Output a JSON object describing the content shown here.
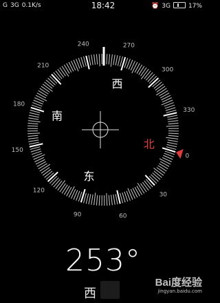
{
  "status_bar": {
    "sim1_signal": "G",
    "sim2_network": "3G",
    "data_speed": "0.1K/s",
    "time": "18:42",
    "alarm_icon": "alarm-icon",
    "network_right": "3G",
    "battery_percent": "17%",
    "battery_level": 0.17
  },
  "compass": {
    "heading_deg": 253,
    "dial_labels": [
      "240",
      "270",
      "300",
      "330",
      "0",
      "30",
      "60",
      "90",
      "120",
      "150",
      "180",
      "210"
    ],
    "cardinals": {
      "north": "北",
      "east": "东",
      "south": "南",
      "west": "西"
    },
    "colors": {
      "north": "#e63939",
      "dial": "#ffffff",
      "degree_text": "#bdbdbd",
      "background": "#000000"
    }
  },
  "readout": {
    "heading_text": "253°",
    "direction_text": "西"
  },
  "watermark": {
    "logo_text": "Bai度经验",
    "url_text": "jingyan.baidu.com"
  }
}
